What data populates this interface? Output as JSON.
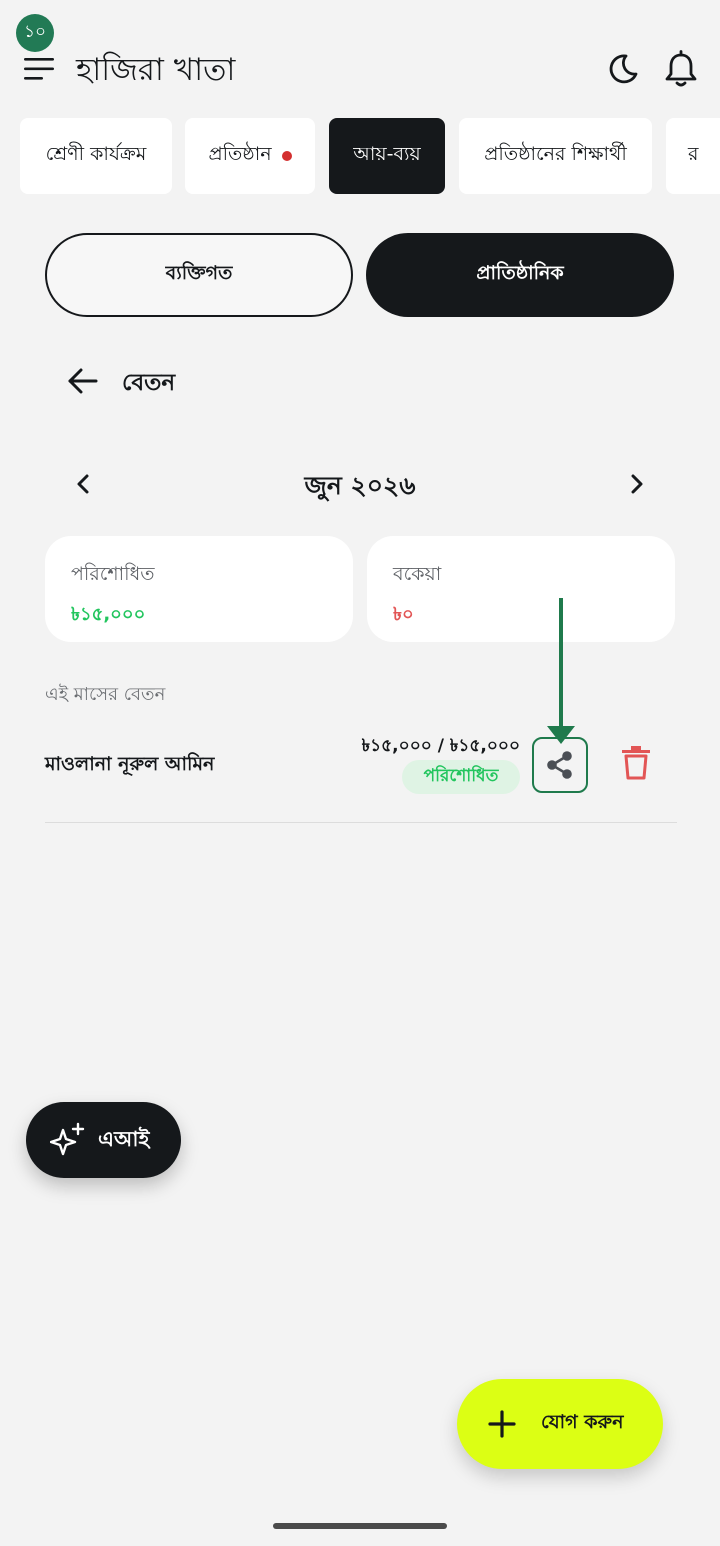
{
  "status": {
    "badge_count": "১০"
  },
  "header": {
    "title": "হাজিরা খাতা"
  },
  "tabs": [
    {
      "label": "শ্রেণী কার্যক্রম",
      "active": false
    },
    {
      "label": "প্রতিষ্ঠান",
      "active": false,
      "has_dot": true
    },
    {
      "label": "আয়-ব্যয়",
      "active": true
    },
    {
      "label": "প্রতিষ্ঠানের শিক্ষার্থী",
      "active": false
    },
    {
      "label": "র",
      "active": false
    }
  ],
  "segment": {
    "personal": "ব্যক্তিগত",
    "institutional": "প্রাতিষ্ঠানিক",
    "selected": "প্রাতিষ্ঠানিক"
  },
  "section": {
    "title": "বেতন"
  },
  "month_nav": {
    "label": "জুন ২০২৬"
  },
  "summary": {
    "paid": {
      "label": "পরিশোধিত",
      "value": "৳১৫,০০০"
    },
    "due": {
      "label": "বকেয়া",
      "value": "৳০"
    }
  },
  "list": {
    "heading": "এই মাসের বেতন",
    "rows": [
      {
        "name": "মাওলানা নূরুল আমিন",
        "amount": "৳১৫,০০০ / ৳১৫,০০০",
        "status": "পরিশোধিত"
      }
    ]
  },
  "fab_ai": {
    "label": "এআই"
  },
  "fab_add": {
    "label": "যোগ করুন"
  },
  "colors": {
    "dark": "#15181b",
    "accent_green": "#22c55e",
    "badge_green": "#227a55",
    "due_red": "#e25555",
    "fab_yellow": "#dcff14",
    "background": "#f3f3f3"
  }
}
